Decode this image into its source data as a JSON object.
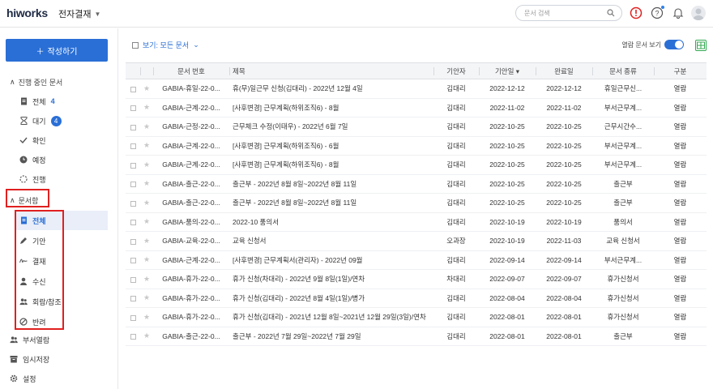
{
  "header": {
    "logo": "hiworks",
    "app_title": "전자결재",
    "search_placeholder": "문서 검색"
  },
  "sidebar": {
    "write_label": "작성하기",
    "in_progress_header": "진행 중인 문서",
    "in_progress_items": [
      {
        "label": "전체",
        "count": "4"
      },
      {
        "label": "대기",
        "count": "4"
      },
      {
        "label": "확인",
        "count": ""
      },
      {
        "label": "예정",
        "count": ""
      },
      {
        "label": "진행",
        "count": ""
      }
    ],
    "archive_header": "문서함",
    "archive_items": [
      {
        "label": "전체"
      },
      {
        "label": "기안"
      },
      {
        "label": "결재"
      },
      {
        "label": "수신"
      },
      {
        "label": "회람/참조"
      },
      {
        "label": "반려"
      }
    ],
    "bottom_items": [
      {
        "label": "부서열람"
      },
      {
        "label": "임시저장"
      },
      {
        "label": "설정"
      }
    ]
  },
  "toolbar": {
    "view_label": "보기: 모든 문서",
    "read_toggle_label": "열람 문서 보기"
  },
  "table": {
    "columns": [
      "문서 번호",
      "제목",
      "기안자",
      "기안일",
      "완료일",
      "문서 종류",
      "구분"
    ],
    "rows": [
      {
        "no": "GABIA-휴일-22-0...",
        "title": "휴(무)일근무 신청(김대리) - 2022년 12월 4일",
        "author": "김대리",
        "draft": "2022-12-12",
        "done": "2022-12-12",
        "type": "휴일근무신...",
        "status": "열람"
      },
      {
        "no": "GABIA-근계-22-0...",
        "title": "[사후변경] 근무계획(하위조직6) - 8월",
        "author": "김대리",
        "draft": "2022-11-02",
        "done": "2022-11-02",
        "type": "부서근무계...",
        "status": "열람"
      },
      {
        "no": "GABIA-근정-22-0...",
        "title": "근무체크 수정(이태우) - 2022년 6월 7일",
        "author": "김대리",
        "draft": "2022-10-25",
        "done": "2022-10-25",
        "type": "근무시간수...",
        "status": "열람"
      },
      {
        "no": "GABIA-근계-22-0...",
        "title": "[사후변경] 근무계획(하위조직6) - 6월",
        "author": "김대리",
        "draft": "2022-10-25",
        "done": "2022-10-25",
        "type": "부서근무계...",
        "status": "열람"
      },
      {
        "no": "GABIA-근계-22-0...",
        "title": "[사후변경] 근무계획(하위조직6) - 8월",
        "author": "김대리",
        "draft": "2022-10-25",
        "done": "2022-10-25",
        "type": "부서근무계...",
        "status": "열람"
      },
      {
        "no": "GABIA-출근-22-0...",
        "title": "출근부 - 2022년 8월 8일~2022년 8월 11일",
        "author": "김대리",
        "draft": "2022-10-25",
        "done": "2022-10-25",
        "type": "출근부",
        "status": "열람"
      },
      {
        "no": "GABIA-출근-22-0...",
        "title": "출근부 - 2022년 8월 8일~2022년 8월 11일",
        "author": "김대리",
        "draft": "2022-10-25",
        "done": "2022-10-25",
        "type": "출근부",
        "status": "열람"
      },
      {
        "no": "GABIA-품의-22-0...",
        "title": "2022-10 품의서",
        "author": "김대리",
        "draft": "2022-10-19",
        "done": "2022-10-19",
        "type": "품의서",
        "status": "열람"
      },
      {
        "no": "GABIA-교육-22-0...",
        "title": "교육 신청서",
        "author": "오과장",
        "draft": "2022-10-19",
        "done": "2022-11-03",
        "type": "교육 신청서",
        "status": "열람"
      },
      {
        "no": "GABIA-근계-22-0...",
        "title": "[사후변경] 근무계획서(관리자) - 2022년 09월",
        "author": "김대리",
        "draft": "2022-09-14",
        "done": "2022-09-14",
        "type": "부서근무계...",
        "status": "열람"
      },
      {
        "no": "GABIA-휴가-22-0...",
        "title": "휴가 신청(차대리) - 2022년 9월 8일(1일)/연차",
        "author": "차대리",
        "draft": "2022-09-07",
        "done": "2022-09-07",
        "type": "휴가신청서",
        "status": "열람"
      },
      {
        "no": "GABIA-휴가-22-0...",
        "title": "휴가 신청(김대리) - 2022년 8월 4일(1일)/병가",
        "author": "김대리",
        "draft": "2022-08-04",
        "done": "2022-08-04",
        "type": "휴가신청서",
        "status": "열람"
      },
      {
        "no": "GABIA-휴가-22-0...",
        "title": "휴가 신청(김대리) - 2021년 12월 8일~2021년 12월 29일(3일)/연차",
        "author": "김대리",
        "draft": "2022-08-01",
        "done": "2022-08-01",
        "type": "휴가신청서",
        "status": "열람"
      },
      {
        "no": "GABIA-출근-22-0...",
        "title": "출근부 - 2022년 7월 29일~2022년 7월 29일",
        "author": "김대리",
        "draft": "2022-08-01",
        "done": "2022-08-01",
        "type": "출근부",
        "status": "열람"
      }
    ]
  },
  "colors": {
    "accent": "#2a6fd6",
    "highlight": "#e02020",
    "alert": "#e02020"
  }
}
